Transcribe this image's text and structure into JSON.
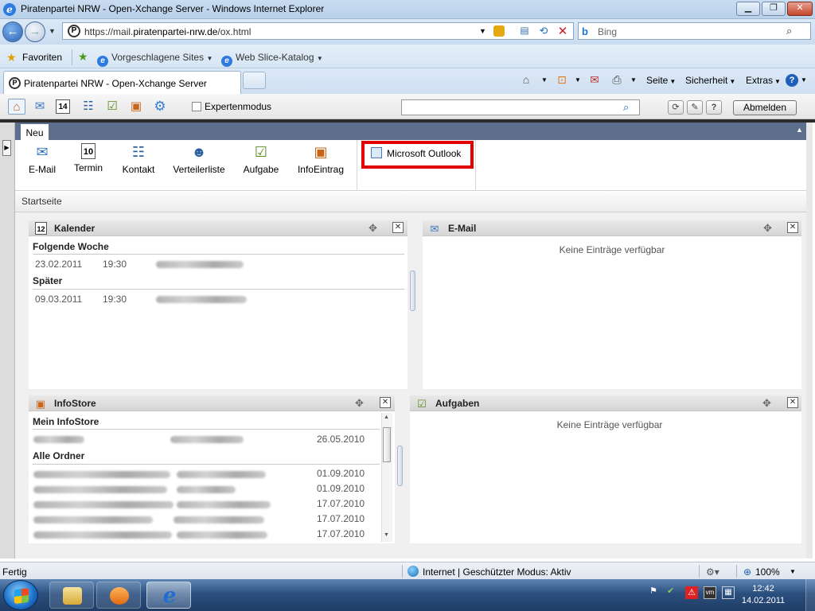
{
  "window": {
    "title": "Piratenpartei NRW - Open-Xchange Server - Windows Internet Explorer",
    "address_host": "https://mail.",
    "address_domain": "piratenpartei-nrw.de",
    "address_path": "/ox.html",
    "search_placeholder": "Bing",
    "favorites_label": "Favoriten",
    "fav_items": [
      "Vorgeschlagene Sites",
      "Web Slice-Katalog"
    ],
    "tab_title": "Piratenpartei NRW - Open-Xchange Server",
    "commands": [
      "Seite",
      "Sicherheit",
      "Extras"
    ]
  },
  "ox": {
    "expert_mode_label": "Expertenmodus",
    "logout_label": "Abmelden",
    "ribbon_tab": "Neu",
    "new_items": [
      "E-Mail",
      "Termin",
      "Kontakt",
      "Verteilerliste",
      "Aufgabe",
      "InfoEintrag"
    ],
    "outlook_label": "Microsoft Outlook",
    "breadcrumb": "Startseite",
    "calendar": {
      "title": "Kalender",
      "icon_day": "12",
      "sections": [
        {
          "label": "Folgende Woche",
          "date": "23.02.2011",
          "time": "19:30"
        },
        {
          "label": "Später",
          "date": "09.03.2011",
          "time": "19:30"
        }
      ]
    },
    "email_widget": {
      "title": "E-Mail",
      "empty": "Keine Einträge verfügbar"
    },
    "infostore": {
      "title": "InfoStore",
      "mine_label": "Mein InfoStore",
      "mine_date": "26.05.2010",
      "all_label": "Alle Ordner",
      "dates": [
        "01.09.2010",
        "01.09.2010",
        "17.07.2010",
        "17.07.2010",
        "17.07.2010"
      ]
    },
    "tasks_widget": {
      "title": "Aufgaben",
      "empty": "Keine Einträge verfügbar"
    }
  },
  "statusbar": {
    "left": "Fertig",
    "zone": "Internet | Geschützter Modus: Aktiv",
    "zoom": "100%"
  },
  "taskbar": {
    "time": "12:42",
    "date": "14.02.2011"
  },
  "colors": {
    "ribbon_tab_bar": "#5d6f8d",
    "highlight_box": "#e00000",
    "taskbar": "#2b4f7e"
  }
}
